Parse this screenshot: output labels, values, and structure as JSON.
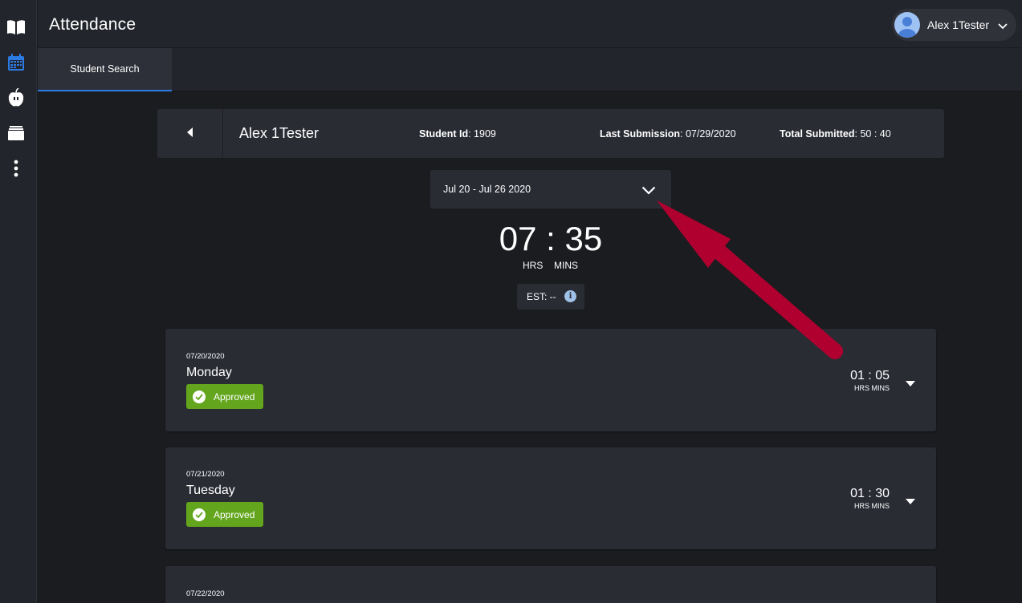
{
  "app": {
    "title": "Attendance"
  },
  "user": {
    "name": "Alex 1Tester"
  },
  "tabs": [
    {
      "label": "Student Search"
    }
  ],
  "student": {
    "name": "Alex 1Tester",
    "id_label": "Student Id",
    "id_value": ": 1909",
    "last_submission_label": "Last Submission",
    "last_submission_value": ": 07/29/2020",
    "total_submitted_label": "Total Submitted",
    "total_submitted_value": ": 50 : 40"
  },
  "week": {
    "selected": "Jul 20 - Jul 26 2020"
  },
  "total": {
    "time": "07 : 35",
    "hrs_label": "HRS",
    "mins_label": "MINS"
  },
  "est": {
    "label": "EST: --"
  },
  "days": [
    {
      "date": "07/20/2020",
      "name": "Monday",
      "status": "Approved",
      "time": "01 : 05",
      "time_label": "HRS MINS"
    },
    {
      "date": "07/21/2020",
      "name": "Tuesday",
      "status": "Approved",
      "time": "01 : 30",
      "time_label": "HRS MINS"
    },
    {
      "date": "07/22/2020"
    }
  ],
  "colors": {
    "background": "#1b1c20",
    "panel": "#2a2c34",
    "approved": "#63a61e",
    "accent": "#2c7be5",
    "annotation_arrow": "#b00030"
  },
  "icons": {
    "rail": [
      "book-icon",
      "calendar-icon",
      "apple-icon",
      "folder-icon",
      "more-vertical-icon"
    ]
  }
}
